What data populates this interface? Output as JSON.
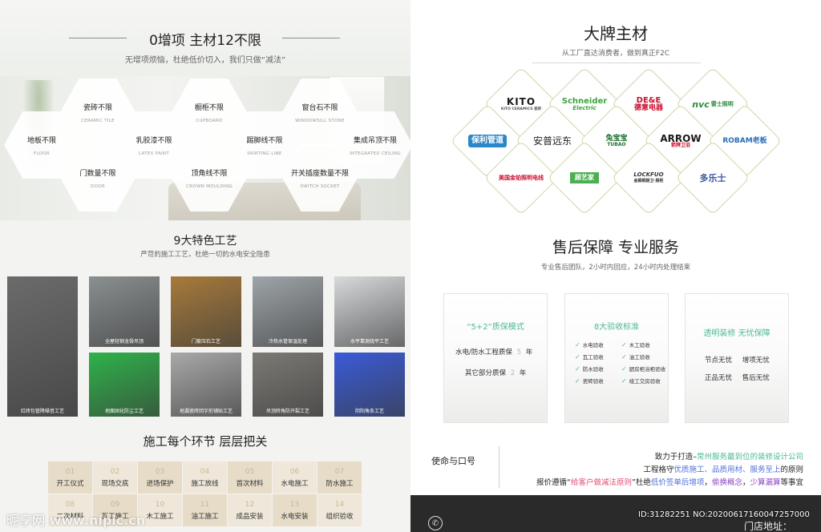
{
  "panel1": {
    "title": "0增项  主材12不限",
    "subtitle": "无增项烦恼，杜绝低价切入，我们只做“减法”",
    "items": [
      {
        "zh": "地板不限",
        "en": "FLOOR"
      },
      {
        "zh": "瓷砖不限",
        "en": "CERAMIC TILE"
      },
      {
        "zh": "门数量不限",
        "en": "DOOR"
      },
      {
        "zh": "乳胶漆不限",
        "en": "LATEX PAINT"
      },
      {
        "zh": "橱柜不限",
        "en": "CUPBOARD"
      },
      {
        "zh": "顶角线不限",
        "en": "CROWN MOULDING"
      },
      {
        "zh": "踢脚线不限",
        "en": "SKIRTING LINE"
      },
      {
        "zh": "窗台石不限",
        "en": "WINDOWSILL STONE"
      },
      {
        "zh": "开关插座数量不限",
        "en": "SWITCH SOCKET"
      },
      {
        "zh": "集成吊顶不限",
        "en": "INTEGRATED CEILING"
      }
    ]
  },
  "panel2": {
    "title": "大牌主材",
    "subtitle": "从工厂直达消费者，做到真正F2C",
    "brands": [
      {
        "name": "KITO",
        "sub": "KITO CERAMICS 瓷砖",
        "color": "#1a1a1a"
      },
      {
        "name": "Schneider",
        "sub": "Electric",
        "color": "#3aa53b"
      },
      {
        "name": "DE&E",
        "sub": "德意电器",
        "color": "#c8102e"
      },
      {
        "name": "nvc",
        "sub": "雷士照明",
        "color": "#2e8b3d"
      },
      {
        "name": "保利管道",
        "sub": "",
        "color": "#2a88c8"
      },
      {
        "name": "安普远东",
        "sub": "",
        "color": "#222222"
      },
      {
        "name": "兔宝宝",
        "sub": "TUBAO",
        "color": "#1b6e2c"
      },
      {
        "name": "ARROW",
        "sub": "箭牌卫浴",
        "color": "#1a1a1a"
      },
      {
        "name": "ROBAM老板",
        "sub": "",
        "color": "#2a6db5"
      },
      {
        "name": "美国金铂照明电线",
        "sub": "",
        "color": "#c8102e"
      },
      {
        "name": "顾艺家",
        "sub": "",
        "color": "#4caf50"
      },
      {
        "name": "LOCKFUO",
        "sub": "金榈铜厨卫·厨柜",
        "color": "#333333"
      },
      {
        "name": "多乐士",
        "sub": "",
        "color": "#3955a3"
      }
    ]
  },
  "panel3": {
    "title": "9大特色工艺",
    "subtitle": "严苛的施工工艺，杜绝一切的水电安全隐患",
    "photos": [
      {
        "cap": "红砖包管降噪音工艺",
        "color": "#6b6b6b"
      },
      {
        "cap": "全屋轻钢龙骨吊顶",
        "color": "#8a8f90"
      },
      {
        "cap": "门套压石工艺",
        "color": "#a77a3b"
      },
      {
        "cap": "冷热水管保温处理",
        "color": "#9ea4a8"
      },
      {
        "cap": "水平靠测找平工艺",
        "color": "#d7d9db"
      },
      {
        "cap": "地面固化防尘工艺",
        "color": "#2fb24a"
      },
      {
        "cap": "地漏瓷砖回字形铺贴工艺",
        "color": "#a9a9a9"
      },
      {
        "cap": "吊顶转角防开裂工艺",
        "color": "#7d7a75"
      },
      {
        "cap": "阴阳角条工艺",
        "color": "#3a5bd8"
      }
    ]
  },
  "panel4": {
    "title": "售后保障  专业服务",
    "subtitle": "专业售后团队，2小时内回应，24小时内处理结束",
    "card1": {
      "title": "“5+2”质保模式",
      "line1_label": "水电/防水工程质保",
      "line1_num": "5",
      "line1_unit": "年",
      "line2_label": "其它部分质保",
      "line2_num": "2",
      "line2_unit": "年"
    },
    "card2": {
      "title": "8大验收标准",
      "items": [
        "水电验收",
        "木工验收",
        "瓦工验收",
        "油工验收",
        "防水验收",
        "厨房柜浴柜验收",
        "瓷砖验收",
        "竣工交房验收"
      ]
    },
    "card3": {
      "title": "透明装修  无忧保障",
      "items": [
        "节点无忧",
        "增项无忧",
        "正品无忧",
        "售后无忧"
      ]
    }
  },
  "panel5": {
    "title": "施工每个环节  层层把关",
    "steps": [
      {
        "n": "01",
        "l": "开工仪式"
      },
      {
        "n": "02",
        "l": "现场交底"
      },
      {
        "n": "03",
        "l": "进场保护"
      },
      {
        "n": "04",
        "l": "施工放线"
      },
      {
        "n": "05",
        "l": "首次材料"
      },
      {
        "n": "06",
        "l": "水电施工"
      },
      {
        "n": "07",
        "l": "防水施工"
      },
      {
        "n": "08",
        "l": "二次材料"
      },
      {
        "n": "09",
        "l": "瓦工施工"
      },
      {
        "n": "10",
        "l": "木工施工"
      },
      {
        "n": "11",
        "l": "油工施工"
      },
      {
        "n": "12",
        "l": "成品安装"
      },
      {
        "n": "13",
        "l": "水电安装"
      },
      {
        "n": "14",
        "l": "组织验收"
      }
    ]
  },
  "panel6": {
    "label": "使命与口号",
    "line1_a": "致力于打造–",
    "line1_b": "常州服务最到位的装修设计公司",
    "line2_a": "工程格守",
    "line2_b": "优质施工、品质用材、服务至上",
    "line2_c": "的原则",
    "line3_a": "报价遵循“",
    "line3_b": "给客户做减法原则",
    "line3_c": "”杜绝",
    "line3_d": "低价签单后增项",
    "line3_e": "，",
    "line3_f": "偷换概念",
    "line3_g": "，",
    "line3_h": "少算漏算",
    "line3_i": "等事宜",
    "store_label": "门店地址：",
    "phone_icon": "phone-icon"
  },
  "watermark": {
    "logo": "昵享网 www.nipic.cn",
    "id": "ID:31282251 NO:20200617160047257000"
  }
}
